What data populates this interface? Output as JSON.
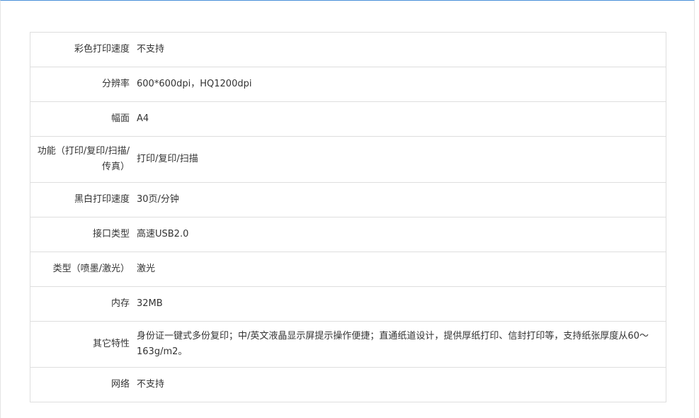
{
  "colors": {
    "accent_line": "#4a90d9",
    "border": "#dedede",
    "text": "#333333"
  },
  "specs": [
    {
      "label": "彩色打印速度",
      "value": "不支持"
    },
    {
      "label": "分辨率",
      "value": "600*600dpi，HQ1200dpi"
    },
    {
      "label": "幅面",
      "value": "A4"
    },
    {
      "label": "功能（打印/复印/扫描/传真）",
      "value": "打印/复印/扫描"
    },
    {
      "label": "黑白打印速度",
      "value": "30页/分钟"
    },
    {
      "label": "接口类型",
      "value": "高速USB2.0"
    },
    {
      "label": "类型（喷墨/激光）",
      "value": "激光"
    },
    {
      "label": "内存",
      "value": "32MB"
    },
    {
      "label": "其它特性",
      "value": "身份证一键式多份复印；中/英文液晶显示屏提示操作便捷；直通纸道设计，提供厚纸打印、信封打印等，支持纸张厚度从60～163g/m2。"
    },
    {
      "label": "网络",
      "value": "不支持"
    }
  ]
}
